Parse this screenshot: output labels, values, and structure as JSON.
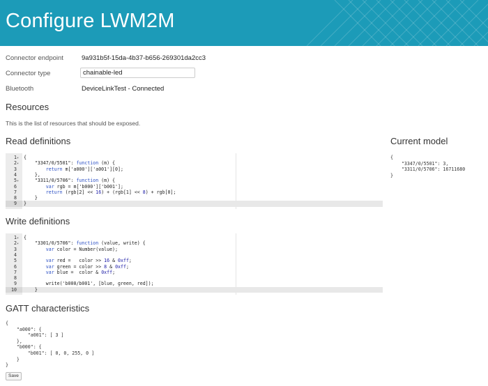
{
  "header": {
    "title": "Configure LWM2M"
  },
  "fields": {
    "endpoint_label": "Connector endpoint",
    "endpoint_value": "9a931b5f-15da-4b37-b656-269301da2cc3",
    "type_label": "Connector type",
    "type_value": "chainable-led",
    "bluetooth_label": "Bluetooth",
    "bluetooth_value": "DeviceLinkTest - Connected"
  },
  "resources": {
    "title": "Resources",
    "description": "This is the list of resources that should be exposed."
  },
  "read": {
    "title": "Read definitions",
    "lines": [
      {
        "n": "1",
        "f": "▾",
        "c": "{"
      },
      {
        "n": "2",
        "f": "▾",
        "c": "    \"3347/0/5501\": function (m) {"
      },
      {
        "n": "3",
        "f": "",
        "c": "        return m['a000']['a001'][0];"
      },
      {
        "n": "4",
        "f": "",
        "c": "    },"
      },
      {
        "n": "5",
        "f": "▾",
        "c": "    \"3311/0/5706\": function (m) {"
      },
      {
        "n": "6",
        "f": "",
        "c": "        var rgb = m['b000']['b001'];"
      },
      {
        "n": "7",
        "f": "",
        "c": "        return (rgb[2] << 16) + (rgb[1] << 8) + rgb[0];"
      },
      {
        "n": "8",
        "f": "",
        "c": "    }"
      },
      {
        "n": "9",
        "f": "",
        "c": "}"
      }
    ],
    "active": 8
  },
  "write": {
    "title": "Write definitions",
    "lines": [
      {
        "n": "1",
        "f": "▾",
        "c": "{"
      },
      {
        "n": "2",
        "f": "▾",
        "c": "    \"3301/0/5706\": function (value, write) {"
      },
      {
        "n": "3",
        "f": "",
        "c": "        var color = Number(value);"
      },
      {
        "n": "4",
        "f": "",
        "c": ""
      },
      {
        "n": "5",
        "f": "",
        "c": "        var red =   color >> 16 & 0xff;"
      },
      {
        "n": "6",
        "f": "",
        "c": "        var green = color >> 8 & 0xff;"
      },
      {
        "n": "7",
        "f": "",
        "c": "        var blue =  color & 0xff;"
      },
      {
        "n": "8",
        "f": "",
        "c": ""
      },
      {
        "n": "9",
        "f": "",
        "c": "        write('b000/b001', [blue, green, red]);"
      },
      {
        "n": "10",
        "f": "",
        "c": "    }"
      }
    ],
    "active": 9
  },
  "model": {
    "title": "Current model",
    "json": "{\n    \"3347/0/5501\": 3,\n    \"3311/0/5706\": 16711680\n}"
  },
  "gatt": {
    "title": "GATT characteristics",
    "json": "{\n    \"a000\": {\n        \"a001\": [ 3 ]\n    },\n    \"b000\": {\n        \"b001\": [ 0, 0, 255, 0 ]\n    }\n}"
  },
  "save_label": "Save",
  "colors": {
    "header_bg": "#1c9bb8",
    "keyword": "#2b4fc4"
  }
}
